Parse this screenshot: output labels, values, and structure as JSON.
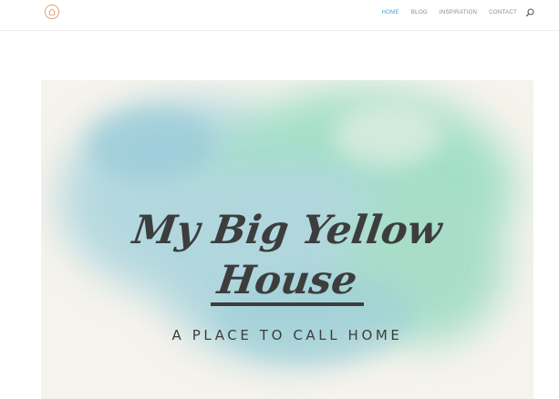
{
  "nav": {
    "items": [
      {
        "label": "HOME"
      },
      {
        "label": "BLOG"
      },
      {
        "label": "INSPIRATION"
      },
      {
        "label": "CONTACT"
      }
    ],
    "active_color": "#45a6d8",
    "text_color": "#8a8a8a"
  },
  "logo": {
    "icon": "house-logo-icon",
    "color": "#e2a27e"
  },
  "search": {
    "icon": "search-icon"
  },
  "hero": {
    "title_line1": "My Big Yellow",
    "title_line2": "House",
    "tagline": "A PLACE TO CALL HOME",
    "text_color": "#3d3d3d",
    "watercolor_colors": [
      "#9ccfd6",
      "#8fd8bd",
      "#b5d8e0"
    ]
  }
}
